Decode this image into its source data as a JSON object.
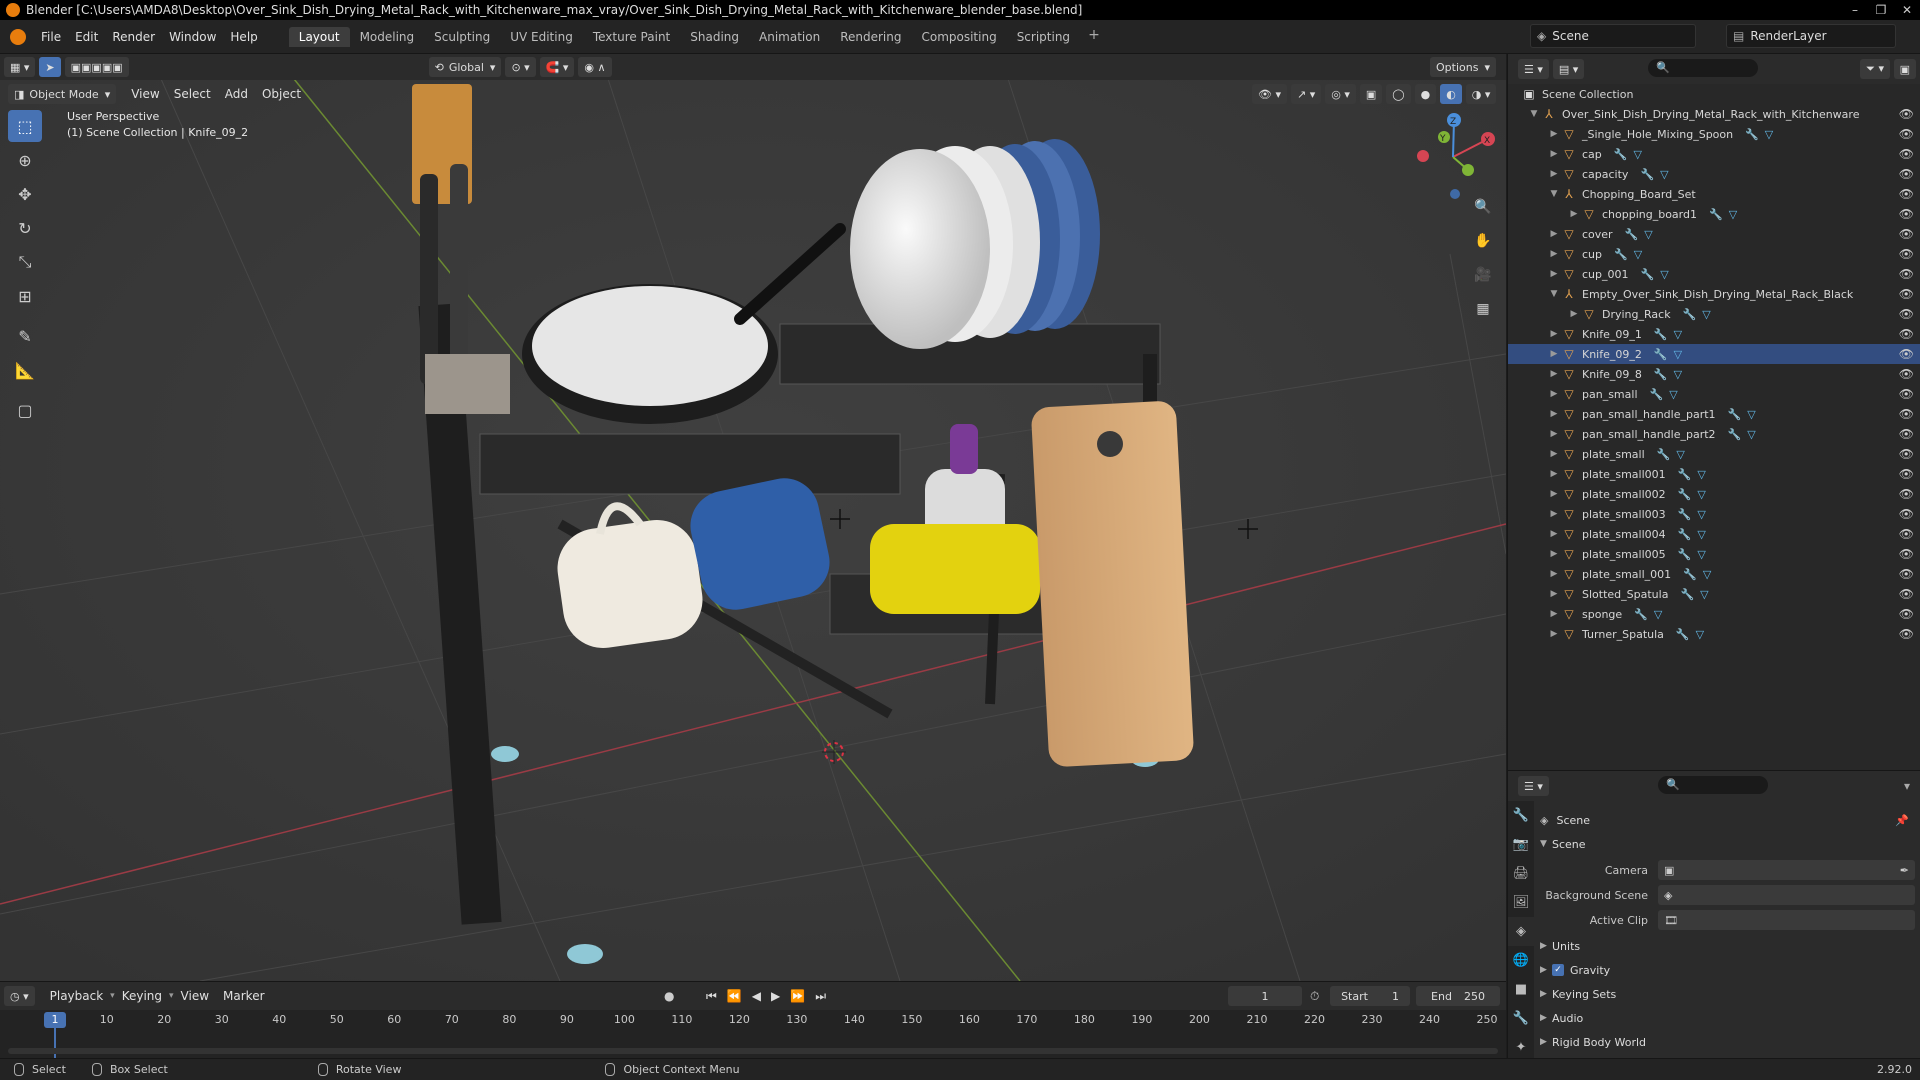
{
  "window": {
    "title": "Blender [C:\\Users\\AMDA8\\Desktop\\Over_Sink_Dish_Drying_Metal_Rack_with_Kitchenware_max_vray/Over_Sink_Dish_Drying_Metal_Rack_with_Kitchenware_blender_base.blend]",
    "controls": [
      "–",
      "❐",
      "✕"
    ]
  },
  "menubar": {
    "items": [
      "File",
      "Edit",
      "Render",
      "Window",
      "Help"
    ],
    "workspaces": [
      "Layout",
      "Modeling",
      "Sculpting",
      "UV Editing",
      "Texture Paint",
      "Shading",
      "Animation",
      "Rendering",
      "Compositing",
      "Scripting"
    ],
    "active_workspace": "Layout",
    "scene": "Scene",
    "view_layer": "RenderLayer"
  },
  "viewport": {
    "mode": "Object Mode",
    "menus": [
      "View",
      "Select",
      "Add",
      "Object"
    ],
    "transform_orientation": "Global",
    "options_label": "Options",
    "perspective_label": "User Perspective",
    "context_label": "(1) Scene Collection | Knife_09_2",
    "gizmo": {
      "x": "X",
      "y": "Y",
      "z": "Z"
    }
  },
  "outliner": {
    "search_placeholder": "",
    "root": "Scene Collection",
    "items": [
      {
        "label": "Over_Sink_Dish_Drying_Metal_Rack_with_Kitchenware",
        "level": 1,
        "expanded": true,
        "kind": "empty"
      },
      {
        "label": "_Single_Hole_Mixing_Spoon",
        "level": 2,
        "kind": "mesh"
      },
      {
        "label": "cap",
        "level": 2,
        "kind": "mesh"
      },
      {
        "label": "capacity",
        "level": 2,
        "kind": "mesh"
      },
      {
        "label": "Chopping_Board_Set",
        "level": 2,
        "expanded": true,
        "kind": "empty"
      },
      {
        "label": "chopping_board1",
        "level": 3,
        "kind": "mesh"
      },
      {
        "label": "cover",
        "level": 2,
        "kind": "mesh"
      },
      {
        "label": "cup",
        "level": 2,
        "kind": "mesh"
      },
      {
        "label": "cup_001",
        "level": 2,
        "kind": "mesh"
      },
      {
        "label": "Empty_Over_Sink_Dish_Drying_Metal_Rack_Black",
        "level": 2,
        "expanded": true,
        "kind": "empty"
      },
      {
        "label": "Drying_Rack",
        "level": 3,
        "kind": "mesh"
      },
      {
        "label": "Knife_09_1",
        "level": 2,
        "kind": "mesh"
      },
      {
        "label": "Knife_09_2",
        "level": 2,
        "kind": "mesh",
        "selected": true
      },
      {
        "label": "Knife_09_8",
        "level": 2,
        "kind": "mesh"
      },
      {
        "label": "pan_small",
        "level": 2,
        "kind": "mesh"
      },
      {
        "label": "pan_small_handle_part1",
        "level": 2,
        "kind": "mesh"
      },
      {
        "label": "pan_small_handle_part2",
        "level": 2,
        "kind": "mesh"
      },
      {
        "label": "plate_small",
        "level": 2,
        "kind": "mesh"
      },
      {
        "label": "plate_small001",
        "level": 2,
        "kind": "mesh"
      },
      {
        "label": "plate_small002",
        "level": 2,
        "kind": "mesh"
      },
      {
        "label": "plate_small003",
        "level": 2,
        "kind": "mesh"
      },
      {
        "label": "plate_small004",
        "level": 2,
        "kind": "mesh"
      },
      {
        "label": "plate_small005",
        "level": 2,
        "kind": "mesh"
      },
      {
        "label": "plate_small_001",
        "level": 2,
        "kind": "mesh"
      },
      {
        "label": "Slotted_Spatula",
        "level": 2,
        "kind": "mesh"
      },
      {
        "label": "sponge",
        "level": 2,
        "kind": "mesh"
      },
      {
        "label": "Turner_Spatula",
        "level": 2,
        "kind": "mesh"
      }
    ]
  },
  "properties": {
    "context": "Scene",
    "panel": "Scene",
    "fields": [
      {
        "label": "Camera",
        "value": ""
      },
      {
        "label": "Background Scene",
        "value": ""
      },
      {
        "label": "Active Clip",
        "value": ""
      }
    ],
    "sections": [
      {
        "label": "Units",
        "checkbox": false
      },
      {
        "label": "Gravity",
        "checkbox": true
      },
      {
        "label": "Keying Sets",
        "checkbox": false
      },
      {
        "label": "Audio",
        "checkbox": false
      },
      {
        "label": "Rigid Body World",
        "checkbox": false
      }
    ]
  },
  "timeline": {
    "menus": [
      "Playback",
      "Keying",
      "View",
      "Marker"
    ],
    "current_frame": "1",
    "start_label": "Start",
    "start": "1",
    "end_label": "End",
    "end": "250",
    "ticks": [
      "10",
      "20",
      "30",
      "40",
      "50",
      "60",
      "70",
      "80",
      "90",
      "100",
      "110",
      "120",
      "130",
      "140",
      "150",
      "160",
      "170",
      "180",
      "190",
      "200",
      "210",
      "220",
      "230",
      "240",
      "250"
    ],
    "playhead": "1"
  },
  "statusbar": {
    "items": [
      "Select",
      "Box Select",
      "Rotate View",
      "Object Context Menu"
    ],
    "version": "2.92.0"
  },
  "colors": {
    "accent": "#4772b3",
    "selection": "#334d80",
    "blender_orange": "#e87d0d",
    "x_axis": "#d64553",
    "y_axis": "#7fb536",
    "z_axis": "#4a8fdc"
  }
}
